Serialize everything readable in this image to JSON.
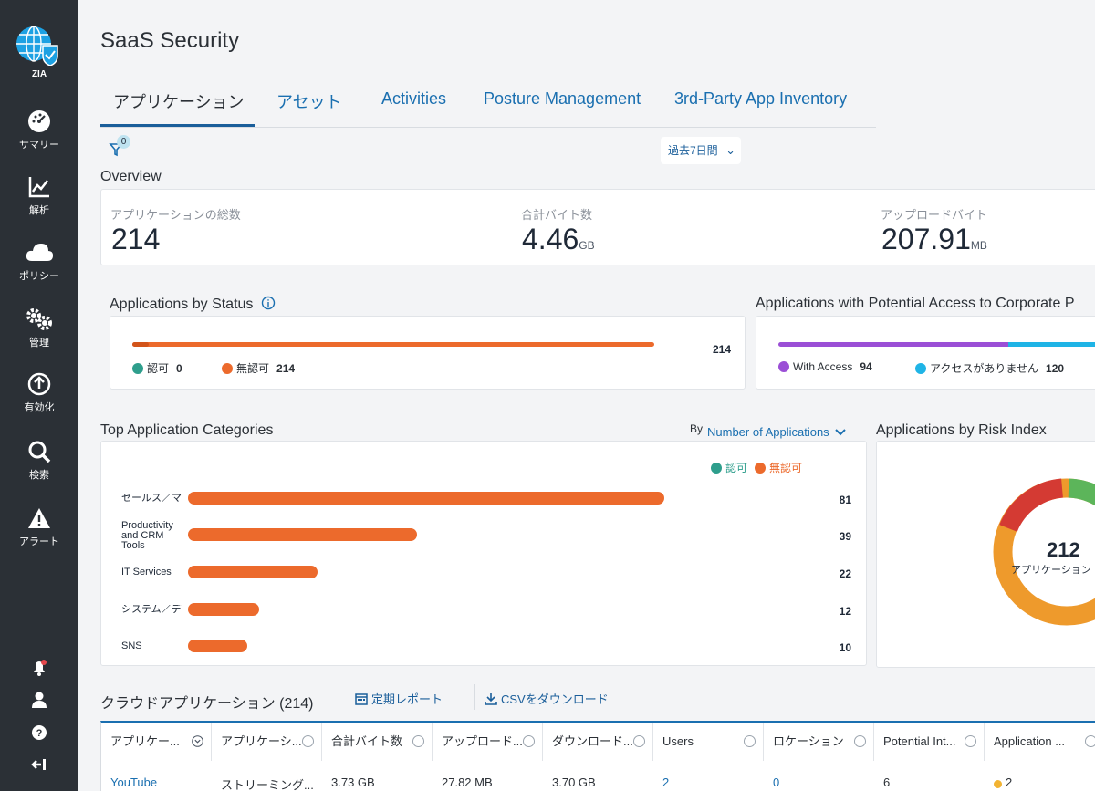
{
  "sidebar": {
    "logo_label": "ZIA",
    "items": [
      {
        "label": "サマリー",
        "icon": "dashboard-icon"
      },
      {
        "label": "解析",
        "icon": "analytics-icon"
      },
      {
        "label": "ポリシー",
        "icon": "cloud-icon"
      },
      {
        "label": "管理",
        "icon": "gears-icon"
      },
      {
        "label": "有効化",
        "icon": "upload-icon"
      },
      {
        "label": "検索",
        "icon": "search-icon"
      },
      {
        "label": "アラート",
        "icon": "warning-icon"
      }
    ],
    "bottom_icons": [
      "notification-bell-icon",
      "user-icon",
      "help-icon",
      "logout-icon"
    ]
  },
  "page": {
    "title": "SaaS Security",
    "tabs": [
      "アプリケーション",
      "アセット",
      "Activities",
      "Posture Management",
      "3rd-Party App Inventory"
    ],
    "active_tab": 0,
    "filter_count": "0",
    "timeframe": "過去7日間"
  },
  "overview": {
    "title": "Overview",
    "kpis": [
      {
        "label": "アプリケーションの総数",
        "value": "214",
        "unit": ""
      },
      {
        "label": "合計バイト数",
        "value": "4.46",
        "unit": "GB"
      },
      {
        "label": "アップロードバイト",
        "value": "207.91",
        "unit": "MB"
      }
    ]
  },
  "status": {
    "title": "Applications by Status",
    "total": "214",
    "sanctioned_label": "認可",
    "sanctioned_value": "0",
    "unsanctioned_label": "無認可",
    "unsanctioned_value": "214",
    "unsanctioned_fraction": 1.0
  },
  "access": {
    "title": "Applications with Potential Access to Corporate P",
    "with_label": "With Access",
    "with_value": "94",
    "without_label": "アクセスがありません",
    "without_value": "120"
  },
  "categories": {
    "title": "Top Application Categories",
    "by_label": "By",
    "metric": "Number of Applications",
    "legend_sanctioned": "認可",
    "legend_unsanctioned": "無認可",
    "items": [
      {
        "label": "セールス／マ",
        "value": "81"
      },
      {
        "label": "Productivity and CRM Tools",
        "value": "39"
      },
      {
        "label": "IT Services",
        "value": "22"
      },
      {
        "label": "システム／デ",
        "value": "12"
      },
      {
        "label": "SNS",
        "value": "10"
      }
    ]
  },
  "risk": {
    "title": "Applications by Risk Index",
    "center_value": "212",
    "center_label": "アプリケーション"
  },
  "cloud_apps": {
    "title": "クラウドアプリケーション (214)",
    "schedule_report": "定期レポート",
    "download_csv": "CSVをダウンロード",
    "columns": [
      "アプリケー...",
      "アプリケーシ...",
      "合計バイト数",
      "アップロード...",
      "ダウンロード...",
      "Users",
      "ロケーション",
      "Potential Int...",
      "Application ..."
    ],
    "rows": [
      [
        "YouTube",
        "ストリーミング...",
        "3.73 GB",
        "27.82 MB",
        "3.70 GB",
        "2",
        "0",
        "6",
        "2"
      ]
    ]
  },
  "colors": {
    "sanctioned": "#2e9e8c",
    "unsanctioned": "#ec6a2c",
    "with_access": "#9b4fd6",
    "without_access": "#1fb4e6",
    "accent": "#1a6fb0"
  }
}
